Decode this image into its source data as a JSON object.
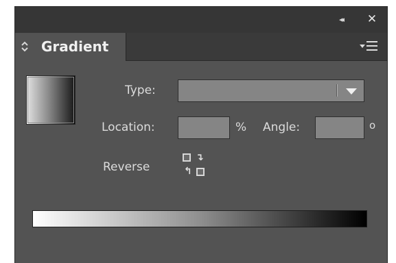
{
  "window": {
    "collapse_icon": "double-chevron-left-icon",
    "collapse_glyph": "◂◂",
    "close_icon": "close-icon",
    "close_glyph": "✕"
  },
  "tab": {
    "label": "Gradient",
    "arrows_icon": "up-down-arrows-icon",
    "arrows_glyph": "⌃⌄"
  },
  "panel_menu_icon": "panel-menu-icon",
  "swatch": {
    "colors": [
      "#ffffff",
      "#000000"
    ]
  },
  "type": {
    "label": "Type:",
    "value": ""
  },
  "location": {
    "label": "Location:",
    "value": "",
    "unit": "%"
  },
  "angle": {
    "label": "Angle:",
    "value": "",
    "unit": "o"
  },
  "reverse": {
    "label": "Reverse",
    "icon": "reverse-gradient-icon"
  },
  "gradient_slider": {
    "start_color": "#ffffff",
    "end_color": "#000000"
  },
  "colors": {
    "panel_bg": "#535353",
    "titlebar_bg": "#363636",
    "field_bg": "#858585",
    "text": "#dcdcdc"
  }
}
